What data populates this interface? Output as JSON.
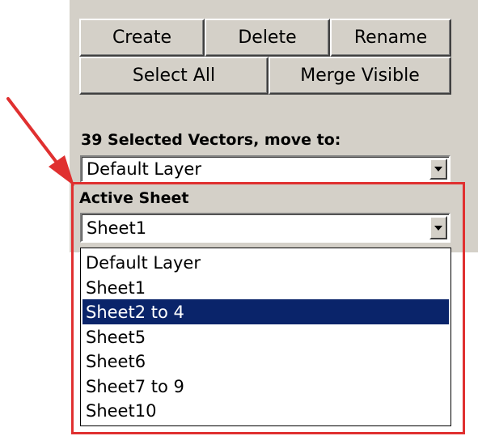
{
  "toolbar": {
    "create_label": "Create",
    "delete_label": "Delete",
    "rename_label": "Rename",
    "select_all_label": "Select All",
    "merge_visible_label": "Merge Visible"
  },
  "move_section": {
    "label": "39 Selected Vectors, move to:",
    "selected_value": "Default Layer"
  },
  "active_sheet": {
    "label": "Active Sheet",
    "selected_value": "Sheet1"
  },
  "dropdown_list": {
    "items": [
      "Default Layer",
      "Sheet1",
      "Sheet2 to 4",
      "Sheet5",
      "Sheet6",
      "Sheet7 to 9",
      "Sheet10"
    ],
    "highlighted_item": "Sheet2 to 4"
  },
  "annotation": {
    "arrow_color": "#e03030",
    "box_color": "#e03030",
    "selection_color": "#0a246a"
  }
}
